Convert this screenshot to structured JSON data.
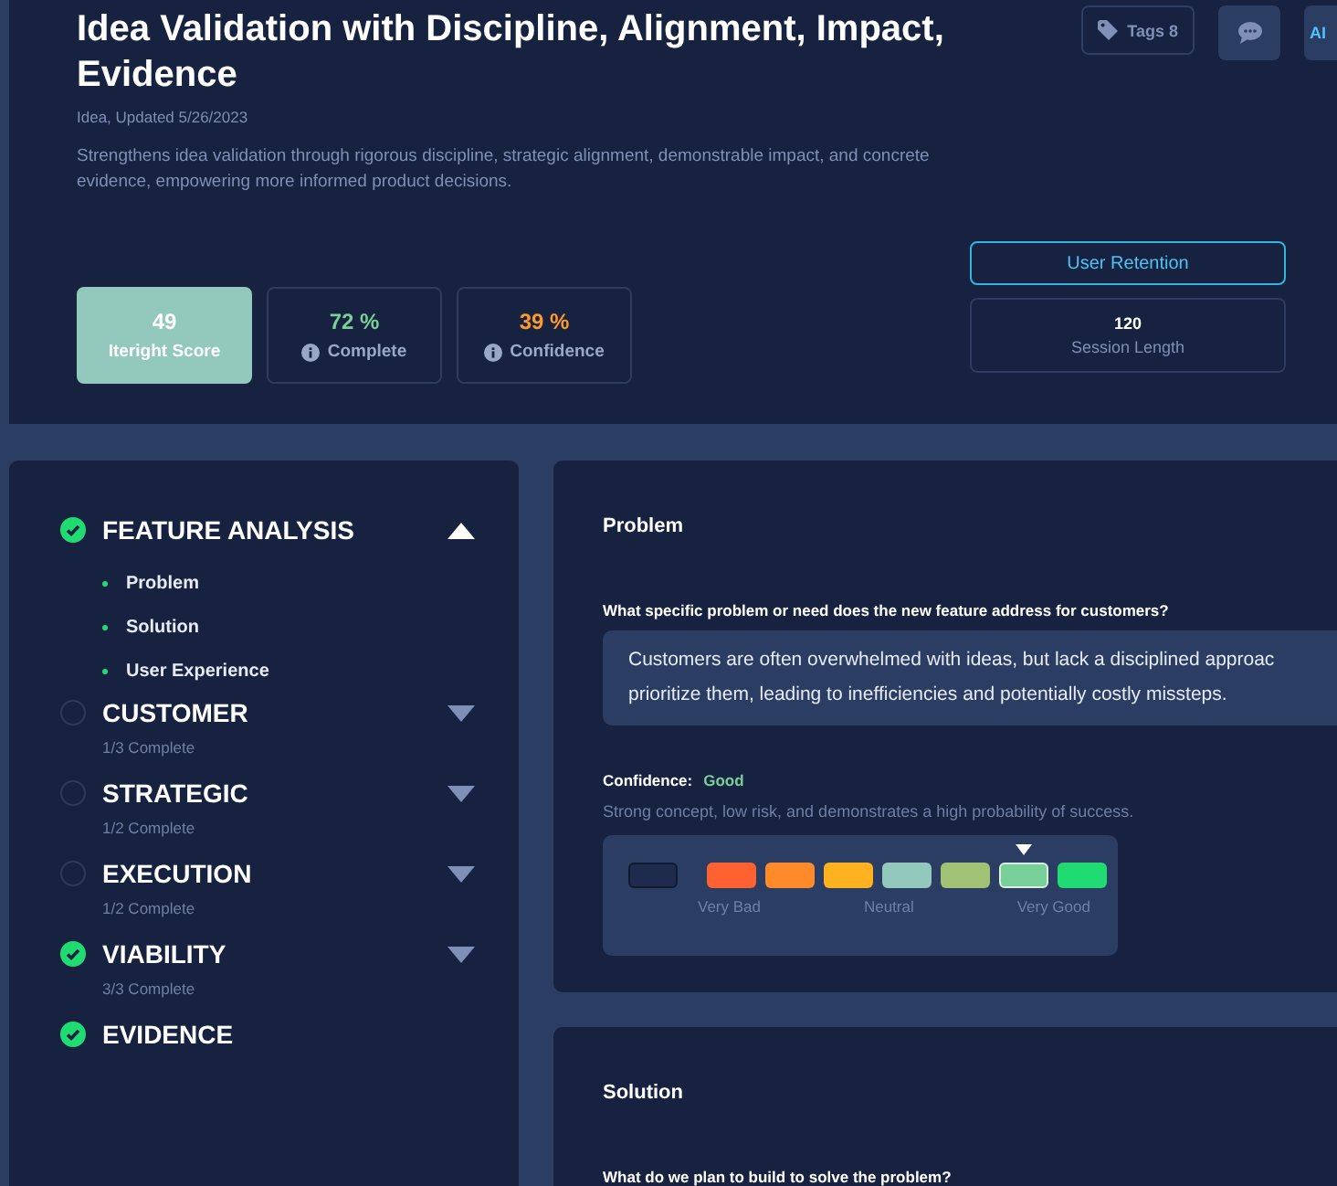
{
  "header": {
    "title": "Idea Validation with Discipline, Alignment, Impact, Evidence",
    "meta": "Idea, Updated 5/26/2023",
    "description": "Strengthens idea validation through rigorous discipline, strategic alignment, demonstrable impact, and concrete evidence, empowering more informed product decisions.",
    "actions": [
      {
        "kind": "tags",
        "label": "Tags 8"
      },
      {
        "kind": "comments"
      },
      {
        "kind": "ai",
        "label": "AI"
      }
    ],
    "scores": [
      {
        "kind": "primary",
        "value": "49",
        "label": "Iteright Score"
      },
      {
        "kind": "complete",
        "value": "72 %",
        "label": "Complete"
      },
      {
        "kind": "confidence",
        "value": "39 %",
        "label": "Confidence"
      }
    ],
    "metric": {
      "button": "User Retention",
      "value": "120",
      "label": "Session Length"
    }
  },
  "sections": [
    {
      "title": "FEATURE ANALYSIS",
      "checked": true,
      "expanded": true,
      "children": [
        {
          "label": "Problem"
        },
        {
          "label": "Solution"
        },
        {
          "label": "User Experience"
        }
      ]
    },
    {
      "title": "CUSTOMER",
      "checked": false,
      "expanded": false,
      "progress": "1/3 Complete"
    },
    {
      "title": "STRATEGIC",
      "checked": false,
      "expanded": false,
      "progress": "1/2 Complete"
    },
    {
      "title": "EXECUTION",
      "checked": false,
      "expanded": false,
      "progress": "1/2 Complete"
    },
    {
      "title": "VIABILITY",
      "checked": true,
      "expanded": false,
      "progress": "3/3 Complete"
    },
    {
      "title": "EVIDENCE",
      "checked": true
    }
  ],
  "cards": [
    {
      "title": "Problem",
      "question": "What specific problem or need does the new feature address for customers?",
      "answer": [
        "Customers are often overwhelmed with ideas, but lack a disciplined approac",
        "prioritize them, leading to inefficiencies and potentially costly missteps."
      ],
      "confidence": {
        "label": "Confidence:",
        "value": "Good",
        "description": "Strong concept, low risk, and demonstrates a high probability of success.",
        "swatches": [
          {
            "kind": "empty",
            "selected": false
          },
          {
            "kind": "color",
            "color": "#ff6130",
            "selected": false
          },
          {
            "kind": "color",
            "color": "#ff8a2a",
            "selected": false
          },
          {
            "kind": "color",
            "color": "#ffb21f",
            "selected": false
          },
          {
            "kind": "color",
            "color": "#93c9bd",
            "selected": false
          },
          {
            "kind": "color",
            "color": "#a1c274",
            "selected": false
          },
          {
            "kind": "color",
            "color": "#79cf98",
            "selected": true
          },
          {
            "kind": "color",
            "color": "#1fdb72",
            "selected": false
          }
        ],
        "scale": [
          "Very Bad",
          "Neutral",
          "Very Good"
        ]
      }
    },
    {
      "title": "Solution",
      "question": "What do we plan to build to solve the problem?"
    }
  ]
}
